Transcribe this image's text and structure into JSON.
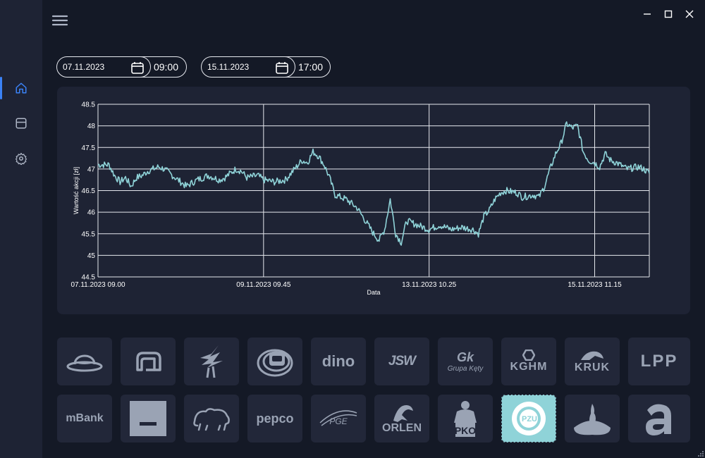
{
  "colors": {
    "background": "#141926",
    "panel": "#1e2334",
    "tile": "#222739",
    "tile_active": "#8fd3d8",
    "line": "#8fd3d8",
    "grid": "#ffffff",
    "accent": "#3b82f6",
    "logo": "#9aa3b4"
  },
  "sidebar": {
    "items": [
      {
        "icon": "home-icon",
        "active": true
      },
      {
        "icon": "layout-icon",
        "active": false
      },
      {
        "icon": "settings-gear-icon",
        "active": false
      }
    ]
  },
  "window": {
    "controls": [
      "minimize-icon",
      "maximize-icon",
      "close-icon"
    ]
  },
  "range": {
    "start_date": "07.11.2023",
    "start_time": "09:00",
    "end_date": "15.11.2023",
    "end_time": "17:00"
  },
  "chart_data": {
    "type": "line",
    "xlabel": "Data",
    "ylabel": "Wartość akcji [zł]",
    "ylim": [
      44.5,
      48.5
    ],
    "yticks": [
      "48.5",
      "48",
      "47.5",
      "47",
      "46.5",
      "46",
      "45.5",
      "45",
      "44.5"
    ],
    "xticks": [
      "07.11.2023 09.00",
      "09.11.2023 09.45",
      "13.11.2023 10.25",
      "15.11.2023 11.15"
    ],
    "grid": true,
    "x_range": [
      0,
      100
    ],
    "series": [
      {
        "points": [
          [
            0,
            47.1
          ],
          [
            2,
            47.1
          ],
          [
            3,
            46.85
          ],
          [
            4,
            46.7
          ],
          [
            5,
            46.8
          ],
          [
            6,
            46.6
          ],
          [
            7,
            46.8
          ],
          [
            8,
            46.85
          ],
          [
            9,
            46.95
          ],
          [
            10,
            47.0
          ],
          [
            11,
            47.05
          ],
          [
            12,
            47.0
          ],
          [
            13,
            46.9
          ],
          [
            14,
            46.8
          ],
          [
            16,
            46.6
          ],
          [
            18,
            46.75
          ],
          [
            20,
            46.85
          ],
          [
            22,
            46.75
          ],
          [
            23,
            46.8
          ],
          [
            25,
            47.0
          ],
          [
            26,
            46.95
          ],
          [
            27,
            46.8
          ],
          [
            29,
            46.85
          ],
          [
            30,
            46.75
          ],
          [
            32,
            46.7
          ],
          [
            34,
            46.75
          ],
          [
            35,
            46.9
          ],
          [
            36,
            47.05
          ],
          [
            37,
            47.2
          ],
          [
            38,
            47.15
          ],
          [
            39,
            47.4
          ],
          [
            40,
            47.3
          ],
          [
            41,
            47.1
          ],
          [
            42,
            46.8
          ],
          [
            43,
            46.4
          ],
          [
            44,
            46.35
          ],
          [
            45,
            46.3
          ],
          [
            46,
            46.2
          ],
          [
            47,
            46.1
          ],
          [
            48,
            45.9
          ],
          [
            49,
            45.7
          ],
          [
            50,
            45.5
          ],
          [
            51,
            45.35
          ],
          [
            52,
            45.6
          ],
          [
            53,
            46.3
          ],
          [
            54,
            45.5
          ],
          [
            55,
            45.3
          ],
          [
            56,
            45.8
          ],
          [
            58,
            45.7
          ],
          [
            60,
            45.6
          ],
          [
            62,
            45.7
          ],
          [
            64,
            45.6
          ],
          [
            66,
            45.65
          ],
          [
            68,
            45.6
          ],
          [
            69,
            45.5
          ],
          [
            70,
            45.9
          ],
          [
            71,
            46.05
          ],
          [
            72,
            46.3
          ],
          [
            73,
            46.45
          ],
          [
            74,
            46.5
          ],
          [
            76,
            46.45
          ],
          [
            77,
            46.35
          ],
          [
            79,
            46.4
          ],
          [
            80,
            46.35
          ],
          [
            81,
            46.6
          ],
          [
            82,
            47.0
          ],
          [
            83,
            47.35
          ],
          [
            84,
            47.6
          ],
          [
            85,
            48.05
          ],
          [
            86,
            47.95
          ],
          [
            87,
            48.0
          ],
          [
            88,
            47.4
          ],
          [
            89,
            47.2
          ],
          [
            90,
            47.15
          ],
          [
            91,
            47.05
          ],
          [
            92,
            47.35
          ],
          [
            93,
            47.2
          ],
          [
            94,
            47.15
          ],
          [
            96,
            47.0
          ],
          [
            98,
            47.05
          ],
          [
            99,
            47.0
          ],
          [
            100,
            46.9
          ]
        ]
      }
    ]
  },
  "companies": [
    {
      "name": "bowler-hat-logo",
      "type": "icon"
    },
    {
      "name": "cyfrowy-polsat-logo",
      "type": "icon"
    },
    {
      "name": "cd-projekt-logo",
      "type": "icon"
    },
    {
      "name": "asseco-logo",
      "type": "icon"
    },
    {
      "name": "dino",
      "text": "dino"
    },
    {
      "name": "jsw",
      "text": "JSW"
    },
    {
      "name": "grupa-kety",
      "text": "Gk",
      "sub": "Grupa Kęty"
    },
    {
      "name": "kghm",
      "text": "KGHM"
    },
    {
      "name": "kruk",
      "text": "KRUK"
    },
    {
      "name": "lpp",
      "text": "LPP"
    },
    {
      "name": "mbank",
      "text": "mBank"
    },
    {
      "name": "pekao-logo",
      "type": "icon"
    },
    {
      "name": "bison-logo",
      "type": "icon"
    },
    {
      "name": "pepco",
      "text": "pepco"
    },
    {
      "name": "pge",
      "text": "PGE"
    },
    {
      "name": "orlen",
      "text": "ORLEN"
    },
    {
      "name": "pko-logo",
      "text": "PKO"
    },
    {
      "name": "pzu",
      "text": "PZU",
      "active": true
    },
    {
      "name": "santander-logo",
      "type": "icon"
    },
    {
      "name": "allegro-logo",
      "type": "icon"
    }
  ]
}
